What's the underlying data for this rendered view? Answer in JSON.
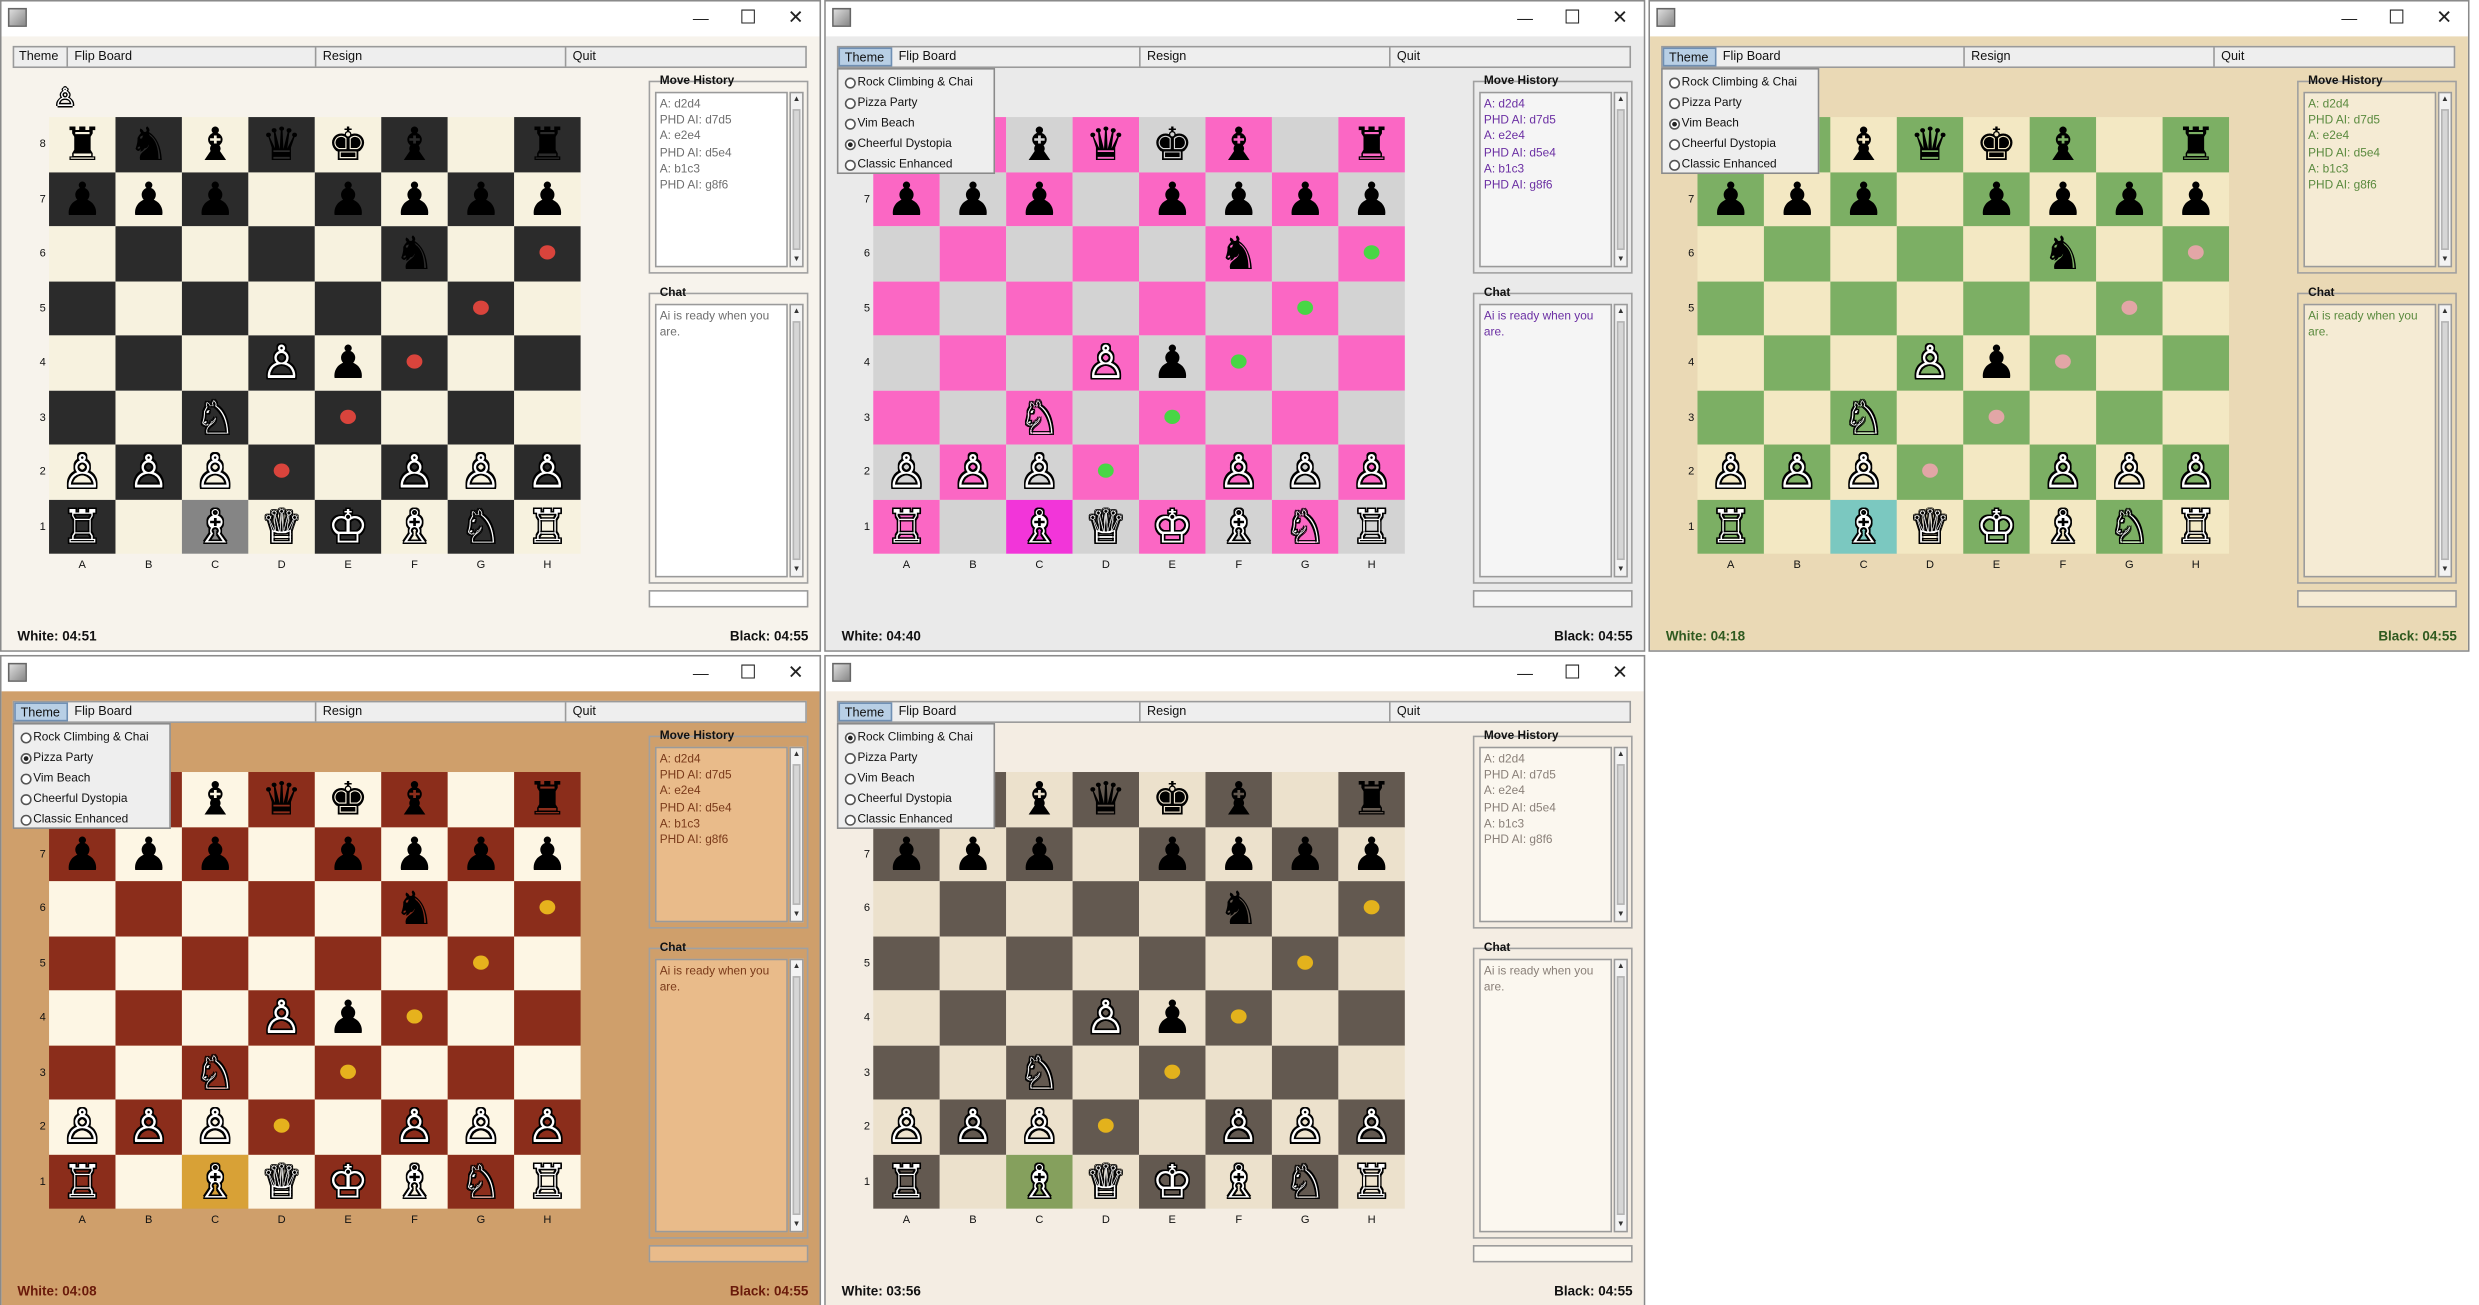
{
  "menu": {
    "theme": "Theme",
    "flip": "Flip Board",
    "resign": "Resign",
    "quit": "Quit"
  },
  "panels": {
    "move_history_title": "Move History",
    "chat_title": "Chat"
  },
  "chat_message": "Ai is ready when you are.",
  "move_history": [
    "A: d2d4",
    "PHD AI:  d7d5",
    "A: e2e4",
    "PHD AI:  d5e4",
    "A: b1c3",
    "PHD AI:  g8f6"
  ],
  "files": [
    "A",
    "B",
    "C",
    "D",
    "E",
    "F",
    "G",
    "H"
  ],
  "ranks": [
    "8",
    "7",
    "6",
    "5",
    "4",
    "3",
    "2",
    "1"
  ],
  "theme_options": [
    "Rock Climbing & Chai",
    "Pizza Party",
    "Vim Beach",
    "Cheerful Dystopia",
    "Classic Enhanced"
  ],
  "captured_piece": "♙",
  "pieces": {
    "a8": "♜",
    "b8": "♞",
    "c8": "♝",
    "d8": "♛",
    "e8": "♚",
    "f8": "♝",
    "h8": "♜",
    "a7": "♟",
    "b7": "♟",
    "c7": "♟",
    "e7": "♟",
    "f7": "♟",
    "g7": "♟",
    "h7": "♟",
    "f6": "♞",
    "e4": "♟",
    "d4": "♙",
    "c3": "♘",
    "a2": "♙",
    "b2": "♙",
    "c2": "♙",
    "f2": "♙",
    "g2": "♙",
    "h2": "♙",
    "a1": "♖",
    "c1": "♗",
    "d1": "♕",
    "e1": "♔",
    "f1": "♗",
    "g1": "♘",
    "h1": "♖"
  },
  "move_dots": [
    "h6",
    "g5",
    "f4",
    "e3",
    "d2"
  ],
  "windows": [
    {
      "id": "win1",
      "white_time": "White: 04:51",
      "black_time": "Black: 04:55",
      "dropdown_open": false,
      "selected_theme": -1,
      "show_captured": true,
      "colors": {
        "bg": "#f7f3ec",
        "light": "#f7f2df",
        "dark": "#2b2b2b",
        "dot": "#d9443c",
        "highlight": "#858585",
        "text": "#6e6e6e",
        "status_text": "#111111",
        "area_bg": "#ffffff"
      }
    },
    {
      "id": "win2",
      "white_time": "White: 04:40",
      "black_time": "Black: 04:55",
      "dropdown_open": true,
      "selected_theme": 3,
      "show_captured": false,
      "colors": {
        "bg": "#eaeaea",
        "light": "#d3d3d3",
        "dark": "#fb67c4",
        "dot": "#48d645",
        "highlight": "#f235d9",
        "text": "#6b2fa3",
        "status_text": "#111111",
        "area_bg": "#f5f5f5"
      }
    },
    {
      "id": "win3",
      "white_time": "White: 04:18",
      "black_time": "Black: 04:55",
      "dropdown_open": true,
      "selected_theme": 2,
      "show_captured": false,
      "colors": {
        "bg": "#ead9b5",
        "light": "#f3e8c3",
        "dark": "#7caf64",
        "dot": "#e2a6a6",
        "highlight": "#7bc8c0",
        "text": "#5a8a3e",
        "status_text": "#2f5a1f",
        "area_bg": "#f5ebd4"
      }
    },
    {
      "id": "win4",
      "white_time": "White: 04:08",
      "black_time": "Black: 04:55",
      "dropdown_open": true,
      "selected_theme": 1,
      "show_captured": false,
      "colors": {
        "bg": "#cf9f6b",
        "light": "#fdf6e4",
        "dark": "#8b2d1b",
        "dot": "#e6b21d",
        "highlight": "#d8a136",
        "text": "#7a3a1a",
        "status_text": "#6a1a0a",
        "area_bg": "#e9bb8a"
      }
    },
    {
      "id": "win5",
      "white_time": "White: 03:56",
      "black_time": "Black: 04:55",
      "dropdown_open": true,
      "selected_theme": 0,
      "show_captured": false,
      "colors": {
        "bg": "#f4ede3",
        "light": "#ece1cc",
        "dark": "#635950",
        "dot": "#e3b21c",
        "highlight": "#85a05d",
        "text": "#8a8079",
        "status_text": "#111111",
        "area_bg": "#fbf7ef"
      }
    }
  ]
}
